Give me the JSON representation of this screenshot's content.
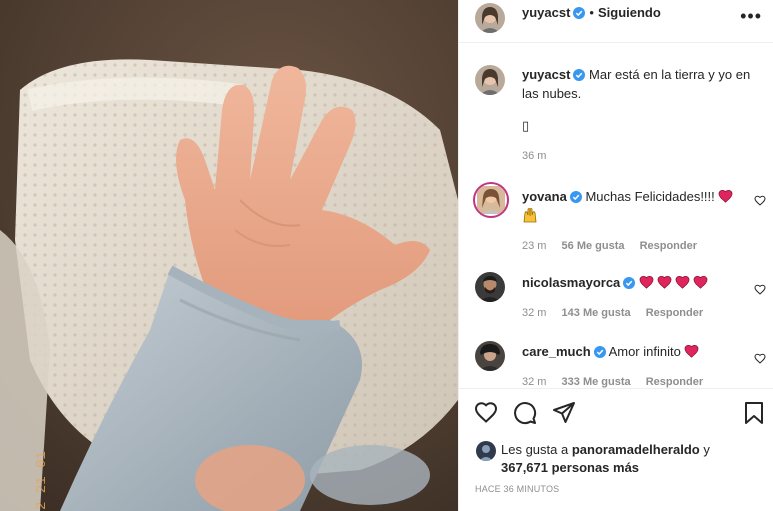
{
  "post": {
    "author": "yuyacst",
    "follow_status": "Siguiendo",
    "dot": "•",
    "more_label": "•••",
    "caption": "Mar está en la tierra y yo en las nubes.",
    "caption_extra": "▯",
    "caption_time": "36 m"
  },
  "photo": {
    "date_stamp": "2  21 01"
  },
  "comments": [
    {
      "user": "yovana",
      "text": "Muchas Felicidades!!!!",
      "emoji": [
        "red-heart",
        "raised-hands"
      ],
      "time": "23 m",
      "likes": "56 Me gusta",
      "reply": "Responder"
    },
    {
      "user": "nicolasmayorca",
      "text": "",
      "emoji": [
        "red-heart",
        "red-heart",
        "red-heart",
        "red-heart"
      ],
      "time": "32 m",
      "likes": "143 Me gusta",
      "reply": "Responder"
    },
    {
      "user": "care_much",
      "text": "Amor infinito",
      "emoji": [
        "red-heart"
      ],
      "time": "32 m",
      "likes": "333 Me gusta",
      "reply": "Responder"
    }
  ],
  "likes": {
    "prefix": "Les gusta a",
    "user": "panoramadelheraldo",
    "conjunction": "y",
    "count": "367,671 personas más"
  },
  "timestamp": "HACE 36 MINUTOS",
  "colors": {
    "verified": "#3897f0",
    "heart": "#e0245e",
    "muted": "#8e8e8e",
    "text": "#262626",
    "border": "#efefef"
  }
}
